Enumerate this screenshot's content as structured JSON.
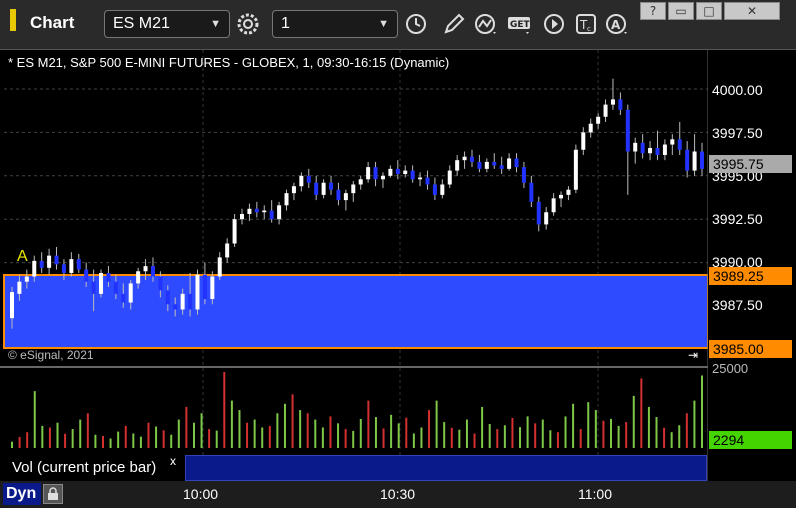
{
  "app": {
    "title": "Chart"
  },
  "toolbar": {
    "symbol": "ES M21",
    "interval": "1",
    "icons": [
      "settings-gear-icon",
      "clock-icon",
      "pencil-draw-icon",
      "study-wave-icon",
      "get-data-icon",
      "play-icon",
      "text-tool-icon",
      "alert-icon"
    ],
    "window_buttons": [
      "help-icon",
      "restore-icon",
      "maximize-icon",
      "close-icon"
    ]
  },
  "chart": {
    "header": "* ES M21, S&P 500 E-MINI FUTURES - GLOBEX, 1, 09:30-16:15 (Dynamic)",
    "copyright": "© eSignal, 2021",
    "marker_label": "A",
    "colors": {
      "up": "#ffffff",
      "down": "#2233ff",
      "zone": "#2f4bff",
      "zone_border": "#ff8c00",
      "vol_up": "#7ec848",
      "vol_down": "#d43030"
    }
  },
  "price_axis": {
    "ticks": [
      "4000.00",
      "3997.50",
      "3995.00",
      "3992.50",
      "3990.00",
      "3987.50"
    ],
    "current_price": "3995.75",
    "zone_high": "3989.25",
    "zone_low": "3985.00"
  },
  "volume": {
    "label": "Vol (current price bar)",
    "close": "x",
    "axis_top": "25000",
    "current": "2294"
  },
  "time_axis": {
    "labels": [
      "10:00",
      "10:30",
      "11:00"
    ]
  },
  "footer": {
    "mode": "Dyn"
  },
  "chart_data": {
    "type": "candlestick",
    "title": "* ES M21, S&P 500 E-MINI FUTURES - GLOBEX, 1, 09:30-16:15 (Dynamic)",
    "ylim": [
      3984.5,
      4001.5
    ],
    "y_ticks": [
      4000.0,
      3997.5,
      3995.0,
      3992.5,
      3990.0,
      3987.5
    ],
    "x_ticks": [
      "10:00",
      "10:30",
      "11:00"
    ],
    "zone": {
      "high": 3989.25,
      "low": 3985.0
    },
    "last": 3995.75,
    "ohlc": [
      [
        3986.8,
        3988.6,
        3986.2,
        3988.3
      ],
      [
        3988.2,
        3989.3,
        3987.8,
        3988.9
      ],
      [
        3988.9,
        3989.6,
        3988.5,
        3989.2
      ],
      [
        3989.2,
        3990.4,
        3988.9,
        3990.1
      ],
      [
        3990.1,
        3990.6,
        3989.4,
        3989.7
      ],
      [
        3989.7,
        3990.8,
        3989.3,
        3990.4
      ],
      [
        3990.4,
        3990.9,
        3989.6,
        3989.9
      ],
      [
        3989.9,
        3990.2,
        3989.0,
        3989.4
      ],
      [
        3989.4,
        3990.6,
        3989.2,
        3990.2
      ],
      [
        3990.2,
        3990.5,
        3989.4,
        3989.6
      ],
      [
        3989.6,
        3990.0,
        3988.6,
        3988.9
      ],
      [
        3988.9,
        3989.6,
        3987.2,
        3988.2
      ],
      [
        3988.2,
        3989.6,
        3988.0,
        3989.4
      ],
      [
        3989.4,
        3989.8,
        3988.6,
        3988.9
      ],
      [
        3988.9,
        3989.3,
        3987.9,
        3988.2
      ],
      [
        3988.2,
        3988.8,
        3987.4,
        3987.7
      ],
      [
        3987.7,
        3989.0,
        3987.3,
        3988.8
      ],
      [
        3988.8,
        3989.7,
        3988.5,
        3989.5
      ],
      [
        3989.5,
        3990.2,
        3989.0,
        3989.8
      ],
      [
        3989.8,
        3990.3,
        3988.9,
        3989.2
      ],
      [
        3989.2,
        3989.5,
        3988.0,
        3988.4
      ],
      [
        3988.4,
        3988.7,
        3987.2,
        3987.6
      ],
      [
        3987.6,
        3988.0,
        3986.9,
        3987.3
      ],
      [
        3987.3,
        3988.5,
        3987.0,
        3988.2
      ],
      [
        3988.2,
        3989.4,
        3986.9,
        3987.3
      ],
      [
        3987.3,
        3989.6,
        3987.0,
        3989.3
      ],
      [
        3989.3,
        3990.0,
        3987.6,
        3987.9
      ],
      [
        3987.9,
        3989.5,
        3987.6,
        3989.2
      ],
      [
        3989.2,
        3990.6,
        3989.0,
        3990.3
      ],
      [
        3990.3,
        3991.4,
        3990.0,
        3991.1
      ],
      [
        3991.1,
        3992.8,
        3990.9,
        3992.5
      ],
      [
        3992.5,
        3993.1,
        3992.2,
        3992.8
      ],
      [
        3992.8,
        3993.4,
        3992.4,
        3993.1
      ],
      [
        3993.1,
        3993.5,
        3992.6,
        3992.9
      ],
      [
        3992.9,
        3993.3,
        3992.5,
        3993.0
      ],
      [
        3993.0,
        3993.6,
        3992.3,
        3992.5
      ],
      [
        3992.5,
        3993.5,
        3992.2,
        3993.3
      ],
      [
        3993.3,
        3994.2,
        3993.0,
        3994.0
      ],
      [
        3994.0,
        3994.6,
        3993.6,
        3994.4
      ],
      [
        3994.4,
        3995.2,
        3994.1,
        3995.0
      ],
      [
        3995.0,
        3995.4,
        3994.3,
        3994.6
      ],
      [
        3994.6,
        3995.0,
        3993.6,
        3993.9
      ],
      [
        3993.9,
        3994.8,
        3993.7,
        3994.6
      ],
      [
        3994.6,
        3995.0,
        3993.9,
        3994.2
      ],
      [
        3994.2,
        3994.6,
        3993.3,
        3993.6
      ],
      [
        3993.6,
        3994.2,
        3993.0,
        3994.0
      ],
      [
        3994.0,
        3994.7,
        3993.5,
        3994.5
      ],
      [
        3994.5,
        3995.0,
        3994.2,
        3994.8
      ],
      [
        3994.8,
        3995.8,
        3994.6,
        3995.5
      ],
      [
        3995.5,
        3995.8,
        3994.4,
        3994.8
      ],
      [
        3994.8,
        3995.2,
        3994.3,
        3995.0
      ],
      [
        3995.0,
        3995.6,
        3994.9,
        3995.4
      ],
      [
        3995.4,
        3995.9,
        3994.8,
        3995.1
      ],
      [
        3995.1,
        3995.6,
        3994.9,
        3995.3
      ],
      [
        3995.3,
        3995.6,
        3994.6,
        3994.8
      ],
      [
        3994.8,
        3995.2,
        3994.4,
        3994.9
      ],
      [
        3994.9,
        3995.3,
        3994.2,
        3994.5
      ],
      [
        3994.5,
        3994.9,
        3993.6,
        3993.9
      ],
      [
        3993.9,
        3994.8,
        3993.7,
        3994.5
      ],
      [
        3994.5,
        3995.6,
        3994.3,
        3995.3
      ],
      [
        3995.3,
        3996.2,
        3995.0,
        3995.9
      ],
      [
        3995.9,
        3996.4,
        3995.4,
        3996.1
      ],
      [
        3996.1,
        3996.5,
        3995.5,
        3995.8
      ],
      [
        3995.8,
        3996.2,
        3995.2,
        3995.4
      ],
      [
        3995.4,
        3996.0,
        3995.2,
        3995.8
      ],
      [
        3995.8,
        3996.3,
        3995.4,
        3995.6
      ],
      [
        3995.6,
        3996.1,
        3995.1,
        3995.4
      ],
      [
        3995.4,
        3996.3,
        3995.3,
        3996.0
      ],
      [
        3996.0,
        3996.3,
        3995.2,
        3995.5
      ],
      [
        3995.5,
        3995.8,
        3994.3,
        3994.6
      ],
      [
        3994.6,
        3995.0,
        3993.2,
        3993.5
      ],
      [
        3993.5,
        3993.8,
        3991.8,
        3992.2
      ],
      [
        3992.2,
        3993.2,
        3991.9,
        3992.9
      ],
      [
        3992.9,
        3994.0,
        3992.7,
        3993.7
      ],
      [
        3993.7,
        3994.1,
        3993.2,
        3993.9
      ],
      [
        3993.9,
        3994.4,
        3993.6,
        3994.2
      ],
      [
        3994.2,
        3996.8,
        3994.0,
        3996.5
      ],
      [
        3996.5,
        3997.8,
        3996.2,
        3997.5
      ],
      [
        3997.5,
        3998.3,
        3997.2,
        3998.0
      ],
      [
        3998.0,
        3998.6,
        3997.7,
        3998.4
      ],
      [
        3998.4,
        3999.4,
        3998.1,
        3999.1
      ],
      [
        3999.1,
        4000.6,
        3998.8,
        3999.4
      ],
      [
        3999.4,
        3999.8,
        3998.5,
        3998.8
      ],
      [
        3998.8,
        3999.1,
        3993.9,
        3996.4
      ],
      [
        3996.4,
        3997.2,
        3995.7,
        3996.9
      ],
      [
        3996.9,
        3997.4,
        3996.0,
        3996.3
      ],
      [
        3996.3,
        3997.0,
        3995.9,
        3996.6
      ],
      [
        3996.6,
        3997.6,
        3995.9,
        3996.2
      ],
      [
        3996.2,
        3997.1,
        3995.9,
        3996.8
      ],
      [
        3996.8,
        3997.4,
        3996.2,
        3997.1
      ],
      [
        3997.1,
        3998.1,
        3996.2,
        3996.5
      ],
      [
        3996.5,
        3997.0,
        3994.9,
        3995.3
      ],
      [
        3995.3,
        3997.4,
        3995.0,
        3996.4
      ],
      [
        3996.4,
        3996.9,
        3995.0,
        3995.4
      ]
    ],
    "volume": [
      200,
      350,
      500,
      1800,
      700,
      650,
      800,
      450,
      600,
      900,
      1100,
      420,
      380,
      300,
      520,
      700,
      460,
      360,
      800,
      680,
      560,
      420,
      900,
      1300,
      800,
      1100,
      600,
      550,
      2500,
      1500,
      1200,
      800,
      900,
      650,
      700,
      1100,
      1400,
      1700,
      1200,
      1100,
      900,
      650,
      1000,
      780,
      600,
      540,
      920,
      1500,
      980,
      620,
      1050,
      780,
      960,
      460,
      650,
      1200,
      1500,
      820,
      640,
      580,
      900,
      460,
      1300,
      760,
      600,
      720,
      950,
      660,
      1000,
      780,
      900,
      560,
      500,
      1000,
      1400,
      600,
      1450,
      1200,
      860,
      920,
      700,
      820,
      1650,
      2200,
      1300,
      980,
      640,
      500,
      720,
      1100,
      1500,
      2294
    ],
    "volume_colors": [
      0,
      1,
      1,
      0,
      0,
      1,
      0,
      1,
      0,
      0,
      1,
      0,
      1,
      0,
      0,
      1,
      0,
      0,
      1,
      0,
      1,
      0,
      0,
      1,
      0,
      0,
      1,
      0,
      1,
      0,
      0,
      1,
      0,
      0,
      1,
      0,
      0,
      1,
      0,
      1,
      0,
      0,
      1,
      0,
      1,
      0,
      0,
      1,
      0,
      1,
      0,
      0,
      1,
      0,
      0,
      1,
      0,
      0,
      1,
      0,
      0,
      1,
      0,
      0,
      1,
      0,
      1,
      0,
      0,
      1,
      0,
      0,
      1,
      0,
      0,
      1,
      0,
      0,
      1,
      0,
      0,
      1,
      0,
      1,
      0,
      0,
      1,
      0,
      0,
      1,
      0,
      0
    ]
  }
}
